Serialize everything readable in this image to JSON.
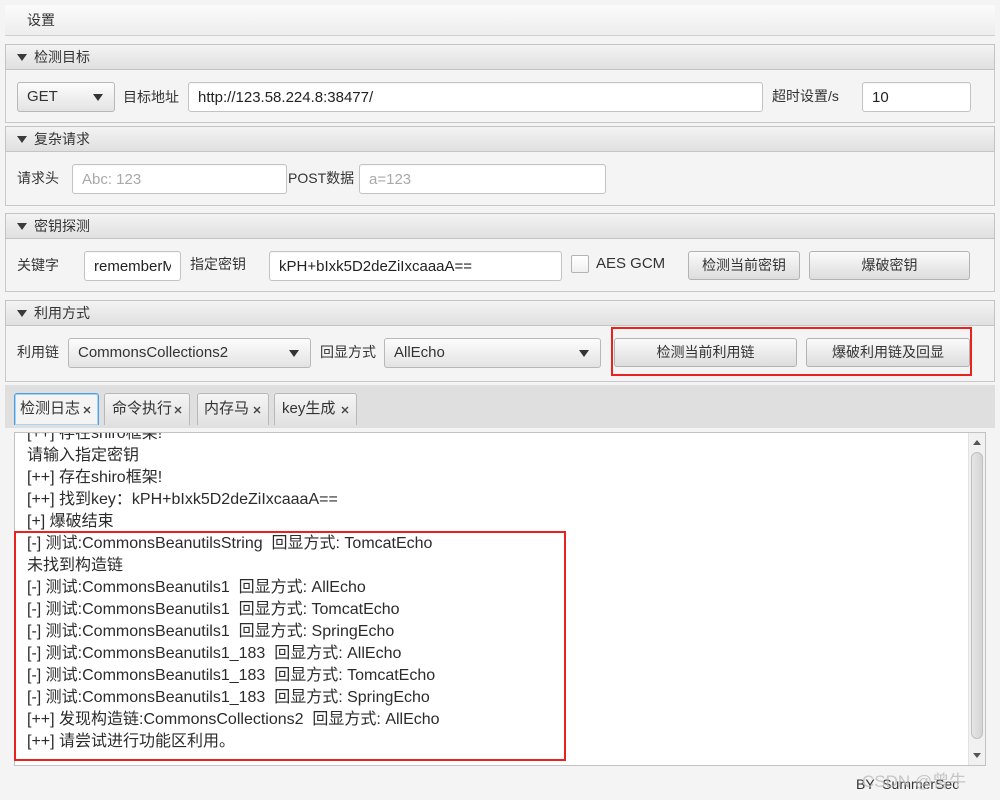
{
  "menu": {
    "settings_label": "设置"
  },
  "target": {
    "title": "检测目标",
    "method": "GET",
    "url_label": "目标地址",
    "url_value": "http://123.58.224.8:38477/",
    "timeout_label": "超时设置/s",
    "timeout_value": "10"
  },
  "complex_request": {
    "title": "复杂请求",
    "headers_label": "请求头",
    "headers_placeholder": "Abc: 123",
    "post_label": "POST数据",
    "post_placeholder": "a=123"
  },
  "key_detection": {
    "title": "密钥探测",
    "keyword_label": "关键字",
    "keyword_value": "rememberMe",
    "key_label": "指定密钥",
    "key_value": "kPH+bIxk5D2deZiIxcaaaA==",
    "aes_gcm_label": "AES GCM",
    "aes_gcm_checked": false,
    "check_button": "检测当前密钥",
    "brute_button": "爆破密钥"
  },
  "exploit": {
    "title": "利用方式",
    "chain_label": "利用链",
    "chain_value": "CommonsCollections2",
    "echo_label": "回显方式",
    "echo_value": "AllEcho",
    "check_button": "检测当前利用链",
    "brute_button": "爆破利用链及回显"
  },
  "tabs": [
    {
      "label": "检测日志",
      "selected": true
    },
    {
      "label": "命令执行",
      "selected": false
    },
    {
      "label": "内存马",
      "selected": false
    },
    {
      "label": "key生成",
      "selected": false
    }
  ],
  "log": {
    "lines": [
      "[++] 存在shiro框架!",
      "请输入指定密钥",
      "[++] 存在shiro框架!",
      "[++] 找到key：kPH+bIxk5D2deZiIxcaaaA==",
      "[+] 爆破结束",
      "[-] 测试:CommonsBeanutilsString  回显方式: TomcatEcho",
      "未找到构造链",
      "[-] 测试:CommonsBeanutils1  回显方式: AllEcho",
      "[-] 测试:CommonsBeanutils1  回显方式: TomcatEcho",
      "[-] 测试:CommonsBeanutils1  回显方式: SpringEcho",
      "[-] 测试:CommonsBeanutils1_183  回显方式: AllEcho",
      "[-] 测试:CommonsBeanutils1_183  回显方式: TomcatEcho",
      "[-] 测试:CommonsBeanutils1_183  回显方式: SpringEcho",
      "[++] 发现构造链:CommonsCollections2  回显方式: AllEcho",
      "[++] 请尝试进行功能区利用。"
    ]
  },
  "footer": {
    "credit": "BY  SummerSec"
  },
  "watermark": "CSDN @曾牛",
  "colors": {
    "highlight_box": "#e8231f",
    "selected_tab_outline": "#4a9fe0",
    "placeholder_text": "#a9a9a9"
  }
}
